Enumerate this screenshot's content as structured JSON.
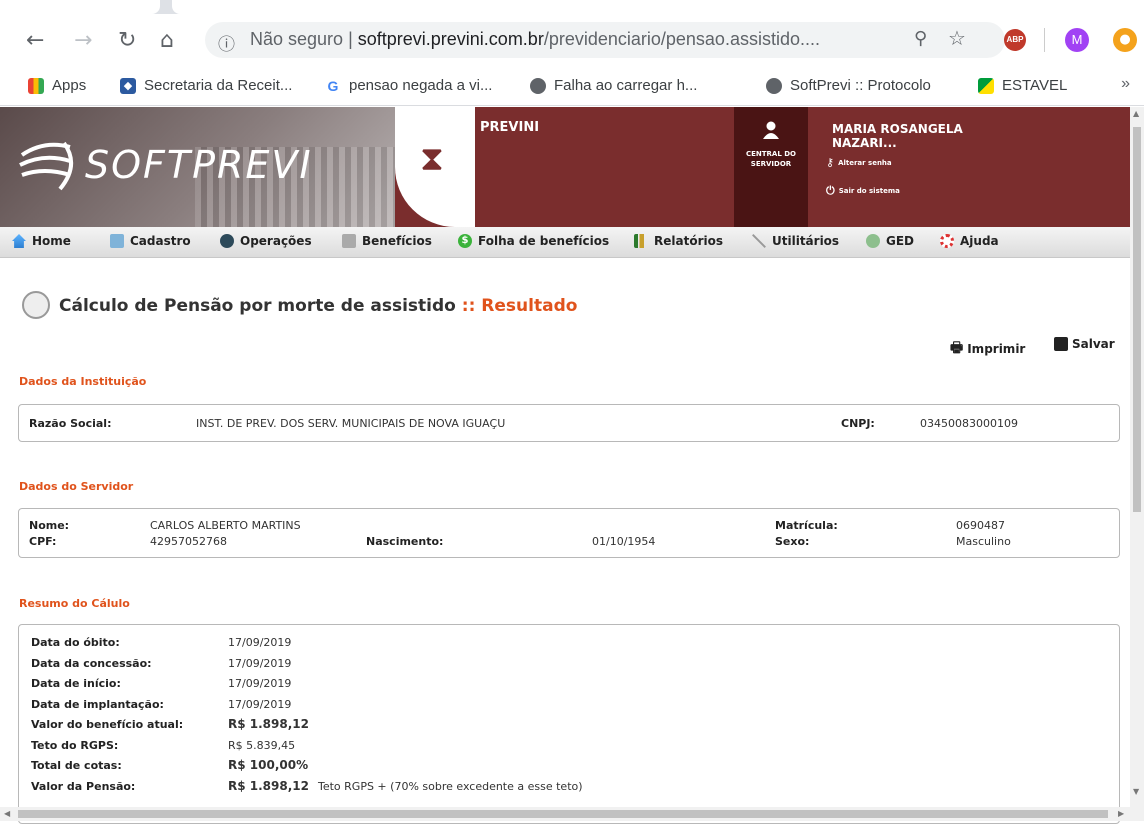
{
  "browser": {
    "url_host": "softprevi.previni.com.br",
    "url_path": "/previdenciario/pensao.assistido....",
    "security_label": "Não seguro",
    "profile_initial": "M",
    "abp_label": "ABP"
  },
  "bookmarks": [
    {
      "label": "Apps"
    },
    {
      "label": "Secretaria da Receit..."
    },
    {
      "label": "pensao negada a vi..."
    },
    {
      "label": "Falha ao carregar h..."
    },
    {
      "label": "SoftPrevi :: Protocolo"
    },
    {
      "label": "ESTAVEL"
    }
  ],
  "bookmarks_more": "»",
  "header": {
    "logo": "SOFTPREVI",
    "org": "PREVINI",
    "central_label_1": "CENTRAL DO",
    "central_label_2": "SERVIDOR",
    "user_name_1": "MARIA ROSANGELA",
    "user_name_2": "NAZARI...",
    "change_password": "Alterar senha",
    "logout": "Sair do sistema"
  },
  "menu": [
    {
      "label": "Home",
      "icon": "home-icon"
    },
    {
      "label": "Cadastro",
      "icon": "cadastro-icon"
    },
    {
      "label": "Operações",
      "icon": "operacoes-icon"
    },
    {
      "label": "Benefícios",
      "icon": "beneficios-icon"
    },
    {
      "label": "Folha de benefícios",
      "icon": "money-icon"
    },
    {
      "label": "Relatórios",
      "icon": "report-icon"
    },
    {
      "label": "Utilitários",
      "icon": "tools-icon"
    },
    {
      "label": "GED",
      "icon": "ged-icon"
    },
    {
      "label": "Ajuda",
      "icon": "help-icon"
    }
  ],
  "page": {
    "title_main": "Cálculo de Pensão por morte de assistido",
    "title_suffix": ":: Resultado",
    "print_label": "Imprimir",
    "save_label": "Salvar"
  },
  "instituicao": {
    "section_title": "Dados da Instituição",
    "razao_label": "Razão Social:",
    "razao_value": "INST. DE PREV. DOS SERV. MUNICIPAIS DE NOVA IGUAÇU",
    "cnpj_label": "CNPJ:",
    "cnpj_value": "03450083000109"
  },
  "servidor": {
    "section_title": "Dados do Servidor",
    "nome_label": "Nome:",
    "nome_value": "CARLOS ALBERTO MARTINS",
    "matricula_label": "Matrícula:",
    "matricula_value": "0690487",
    "cpf_label": "CPF:",
    "cpf_value": "42957052768",
    "nascimento_label": "Nascimento:",
    "nascimento_value": "01/10/1954",
    "sexo_label": "Sexo:",
    "sexo_value": "Masculino"
  },
  "resumo": {
    "section_title": "Resumo do Cálulo",
    "rows": [
      {
        "label": "Data do óbito:",
        "value": "17/09/2019",
        "bold": false
      },
      {
        "label": "Data da concessão:",
        "value": "17/09/2019",
        "bold": false
      },
      {
        "label": "Data de início:",
        "value": "17/09/2019",
        "bold": false
      },
      {
        "label": "Data de implantação:",
        "value": "17/09/2019",
        "bold": false
      },
      {
        "label": "Valor do benefício atual:",
        "value": "R$ 1.898,12",
        "bold": true
      },
      {
        "label": "Teto do RGPS:",
        "value": "R$ 5.839,45",
        "bold": false
      },
      {
        "label": "Total de cotas:",
        "value": "R$ 100,00%",
        "bold": true
      },
      {
        "label": "Valor da Pensão:",
        "value": "R$ 1.898,12",
        "bold": true,
        "note": "Teto RGPS + (70% sobre excedente a esse teto)"
      }
    ]
  }
}
